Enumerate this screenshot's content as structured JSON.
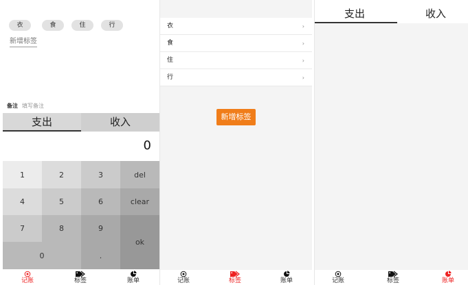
{
  "record": {
    "tags": [
      "衣",
      "食",
      "住",
      "行"
    ],
    "add_tag_link": "新增标签",
    "note_label": "备注",
    "note_placeholder": "填写备注",
    "type_tabs": [
      "支出",
      "收入"
    ],
    "amount": "0",
    "keys": {
      "k1": "1",
      "k2": "2",
      "k3": "3",
      "del": "del",
      "k4": "4",
      "k5": "5",
      "k6": "6",
      "clear": "clear",
      "k7": "7",
      "k8": "8",
      "k9": "9",
      "ok": "ok",
      "k0": "0",
      "dot": "."
    }
  },
  "tags_page": {
    "items": [
      "衣",
      "食",
      "住",
      "行"
    ],
    "chevron": "›",
    "add_button": "新增标签"
  },
  "bills": {
    "tabs": [
      "支出",
      "收入"
    ]
  },
  "nav": {
    "items": [
      "记账",
      "标签",
      "账单"
    ]
  },
  "colors": {
    "accent": "#f07d1a",
    "nav_active": "#ee2222"
  }
}
